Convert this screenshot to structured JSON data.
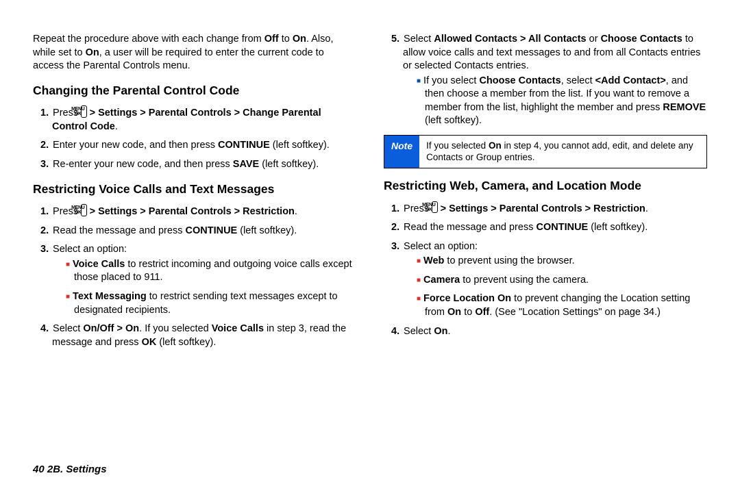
{
  "intro": {
    "p1a": "Repeat the procedure above with each change from ",
    "off": "Off",
    "p1b": " to ",
    "on": "On",
    "p1c": ". Also, while set to ",
    "p1d": ", a user will be required to enter the current code to access the Parental Controls menu."
  },
  "sec1": {
    "heading": "Changing the Parental Control Code",
    "s1a": "Press ",
    "s1b": " > Settings > Parental Controls > Change Parental Control Code",
    "s1c": ".",
    "s2a": "Enter your new code, and then press ",
    "s2b": "CONTINUE",
    "s2c": " (left softkey).",
    "s3a": "Re-enter your new code, and then press ",
    "s3b": "SAVE",
    "s3c": " (left softkey)."
  },
  "sec2": {
    "heading": "Restricting Voice Calls and Text Messages",
    "s1a": "Press ",
    "s1b": " > Settings > Parental Controls > Restriction",
    "s1c": ".",
    "s2a": "Read the message and press ",
    "s2b": "CONTINUE",
    "s2c": " (left softkey).",
    "s3": "Select an option:",
    "b1a": "Voice Calls",
    "b1b": " to restrict incoming and outgoing voice calls except those placed to 911.",
    "b2a": "Text Messaging",
    "b2b": " to restrict sending text messages except to designated recipients.",
    "s4a": "Select ",
    "s4b": "On/Off > On",
    "s4c": ". If you selected ",
    "s4d": "Voice Calls",
    "s4e": " in step 3, read the message and press ",
    "s4f": "OK",
    "s4g": " (left softkey)."
  },
  "sec2r": {
    "s5a": "Select ",
    "s5b": "Allowed Contacts > All Contacts",
    "s5c": " or ",
    "s5d": "Choose Contacts",
    "s5e": " to allow voice calls and text messages to and from all Contacts entries or selected Contacts entries.",
    "b1a": "If you select ",
    "b1b": "Choose Contacts",
    "b1c": ", select ",
    "b1d": "<Add Contact>",
    "b1e": ", and then choose a member from the list. If you want to remove a member from the list, highlight the member and press ",
    "b1f": "REMOVE",
    "b1g": " (left softkey)."
  },
  "note": {
    "label": "Note",
    "a": "If you selected ",
    "b": "On",
    "c": " in step 4, you cannot add, edit, and delete any Contacts or Group entries."
  },
  "sec3": {
    "heading": "Restricting Web, Camera, and Location Mode",
    "s1a": "Press ",
    "s1b": " > Settings > Parental Controls > Restriction",
    "s1c": ".",
    "s2a": "Read the message and press ",
    "s2b": "CONTINUE",
    "s2c": " (left softkey).",
    "s3": "Select an option:",
    "b1a": "Web",
    "b1b": " to prevent using the browser.",
    "b2a": "Camera",
    "b2b": " to prevent using the camera.",
    "b3a": "Force Location On",
    "b3b": " to prevent changing the Location setting from ",
    "b3c": "On",
    "b3d": " to ",
    "b3e": "Off",
    "b3f": ". (See \"Location Settings\" on page 34.)",
    "s4a": "Select ",
    "s4b": "On",
    "s4c": "."
  },
  "footer": {
    "page": "40",
    "sep": "    ",
    "section": "2B. Settings"
  },
  "nums": {
    "n1": "1.",
    "n2": "2.",
    "n3": "3.",
    "n4": "4.",
    "n5": "5."
  },
  "menu_key": {
    "top": "MENU",
    "bot": "OK"
  }
}
